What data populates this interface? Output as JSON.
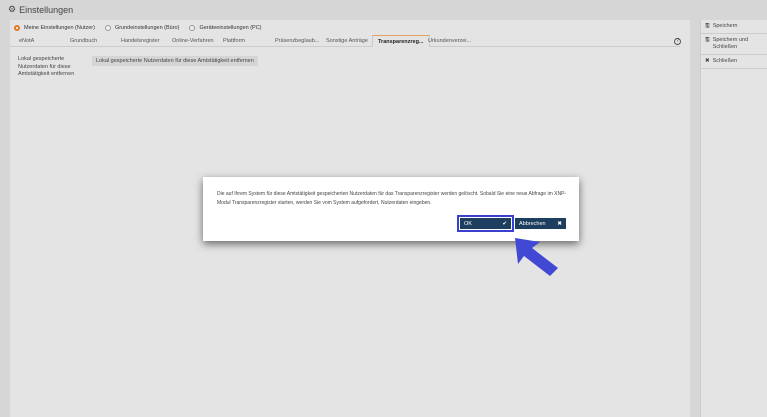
{
  "header": {
    "title": "Einstellungen"
  },
  "radios": [
    {
      "label": "Meine Einstellungen (Nutzer)",
      "checked": true
    },
    {
      "label": "Grundeinstellungen (Büro)",
      "checked": false
    },
    {
      "label": "Geräteeinstellungen (PC)",
      "checked": false
    }
  ],
  "tabs": [
    "eNotA",
    "Grundbuch",
    "Handelsregister",
    "Online-Verfahren",
    "Plattform",
    "Präsenzbeglaub...",
    "Sonstige Anträge",
    "Transparenzreg...",
    "Urkundenverzei..."
  ],
  "active_tab": "Transparenzreg...",
  "content": {
    "label": "Lokal gespeicherte Nutzerdaten für diese Amtstätigkeit entfernen",
    "button": "Lokal gespeicherte Nutzerdaten für diese Amtstätigkeit entfernen"
  },
  "sidebar": {
    "save": "Speichern",
    "save_close": "Speichern und Schließen",
    "close": "Schließen"
  },
  "dialog": {
    "message": "Die auf Ihrem System für diese Amtstätigkeit gespeicherten Nutzerdaten für das Transparenzregister werden gelöscht. Sobald Sie eine neue Abfrage im XNP-Modul Transparenzregister starten, werden Sie vom System aufgefordert, Nutzerdaten eingeben.",
    "ok": "OK",
    "cancel": "Abbrechen"
  },
  "help": "?"
}
